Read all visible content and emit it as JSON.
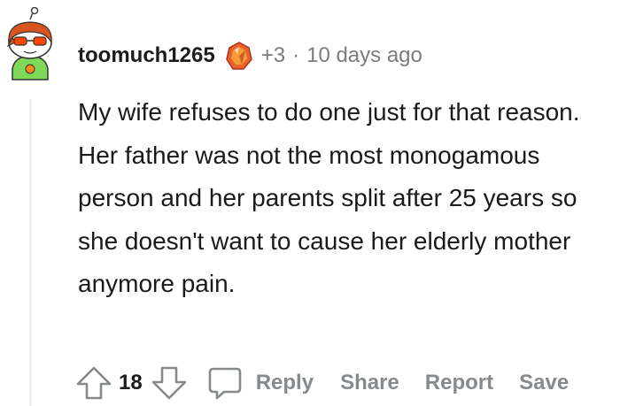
{
  "comment": {
    "username": "toomuch1265",
    "award_count": "+3",
    "separator": "·",
    "timestamp": "10 days ago",
    "body": "My wife refuses to do one just for that reason. Her father was not the most monogamous person and her parents split after 25 years so she doesn't want to cause her elderly mother anymore pain.",
    "score": "18"
  },
  "actions": {
    "reply_label": "Reply",
    "share_label": "Share",
    "report_label": "Report",
    "save_label": "Save"
  },
  "icons": {
    "avatar": "snoo-avatar",
    "award": "award-icon",
    "upvote": "upvote-arrow-icon",
    "downvote": "downvote-arrow-icon",
    "reply": "comment-bubble-icon"
  },
  "colors": {
    "text": "#1a1a1b",
    "meta": "#7c7c7c",
    "action": "#878a8c",
    "thread_line": "#edeff1",
    "avatar_hair": "#d9541e"
  }
}
